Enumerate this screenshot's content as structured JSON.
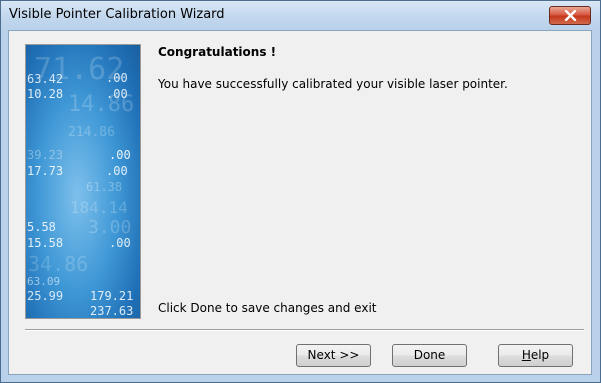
{
  "window": {
    "title": "Visible Pointer Calibration Wizard"
  },
  "content": {
    "heading": "Congratulations !",
    "message": "You have successfully calibrated your visible laser pointer.",
    "hint": "Click Done to save changes and exit"
  },
  "buttons": {
    "next": "Next >>",
    "done": "Done",
    "help_mnemonic": "H",
    "help_rest": "elp"
  },
  "side_image_numbers": [
    "71.62",
    "63.42",
    ".00",
    "10.28",
    "14.86",
    ".00",
    "214.86",
    "39.23",
    ".00",
    "17.73",
    ".00",
    "61.38",
    "184.14",
    "5.58",
    "3.00",
    "15.58",
    ".00",
    "34.86",
    "63.09",
    "25.99",
    "179.21",
    "237.63"
  ],
  "colors": {
    "title_bar": "#c3d8ee",
    "close_button": "#c4361a",
    "dialog_background": "#f0f0f0",
    "side_image_blue": "#3f98d6"
  }
}
